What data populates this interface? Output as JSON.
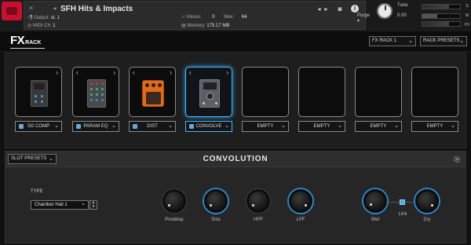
{
  "kontakt": {
    "instrument_name": "SFH Hits & Impacts",
    "output_label": "Output:",
    "output_value": "st. 1",
    "midi_label": "MIDI Ch:",
    "midi_value": "1",
    "voices_label": "Voices:",
    "voices_value": "0",
    "max_label": "Max:",
    "max_value": "64",
    "memory_label": "Memory:",
    "memory_value": "175.17 MB",
    "purge_label": "Purge",
    "tune_label": "Tune",
    "tune_value": "0.00",
    "side_letters": [
      "S",
      "M",
      "PV"
    ]
  },
  "rack": {
    "logo_fx": "FX",
    "logo_rack": "RACK",
    "rack_select": "FX RACK 1",
    "presets_select": "RACK PRESETS"
  },
  "slots": [
    {
      "label": "SG COMP",
      "active": false,
      "pedal": "comp"
    },
    {
      "label": "PARAM EQ",
      "active": false,
      "pedal": "eq"
    },
    {
      "label": "DIST",
      "active": false,
      "pedal": "dist"
    },
    {
      "label": "CONVOLVE",
      "active": true,
      "pedal": "convolve"
    },
    {
      "label": "EMPTY",
      "active": false,
      "pedal": "none"
    },
    {
      "label": "EMPTY",
      "active": false,
      "pedal": "none"
    },
    {
      "label": "EMPTY",
      "active": false,
      "pedal": "none"
    },
    {
      "label": "EMPTY",
      "active": false,
      "pedal": "none"
    }
  ],
  "panel": {
    "slot_presets": "SLOT PRESETS",
    "title": "CONVOLUTION",
    "type_label": "TYPE",
    "type_value": "Chamber Hall 1",
    "knobs": [
      "Predelay",
      "Size",
      "HPF",
      "LPF",
      "Wet",
      "Dry"
    ],
    "link_label": "Link"
  },
  "colors": {
    "accent": "#43b8ff",
    "brand": "#c8102e",
    "dist_pedal": "#e46a18"
  }
}
